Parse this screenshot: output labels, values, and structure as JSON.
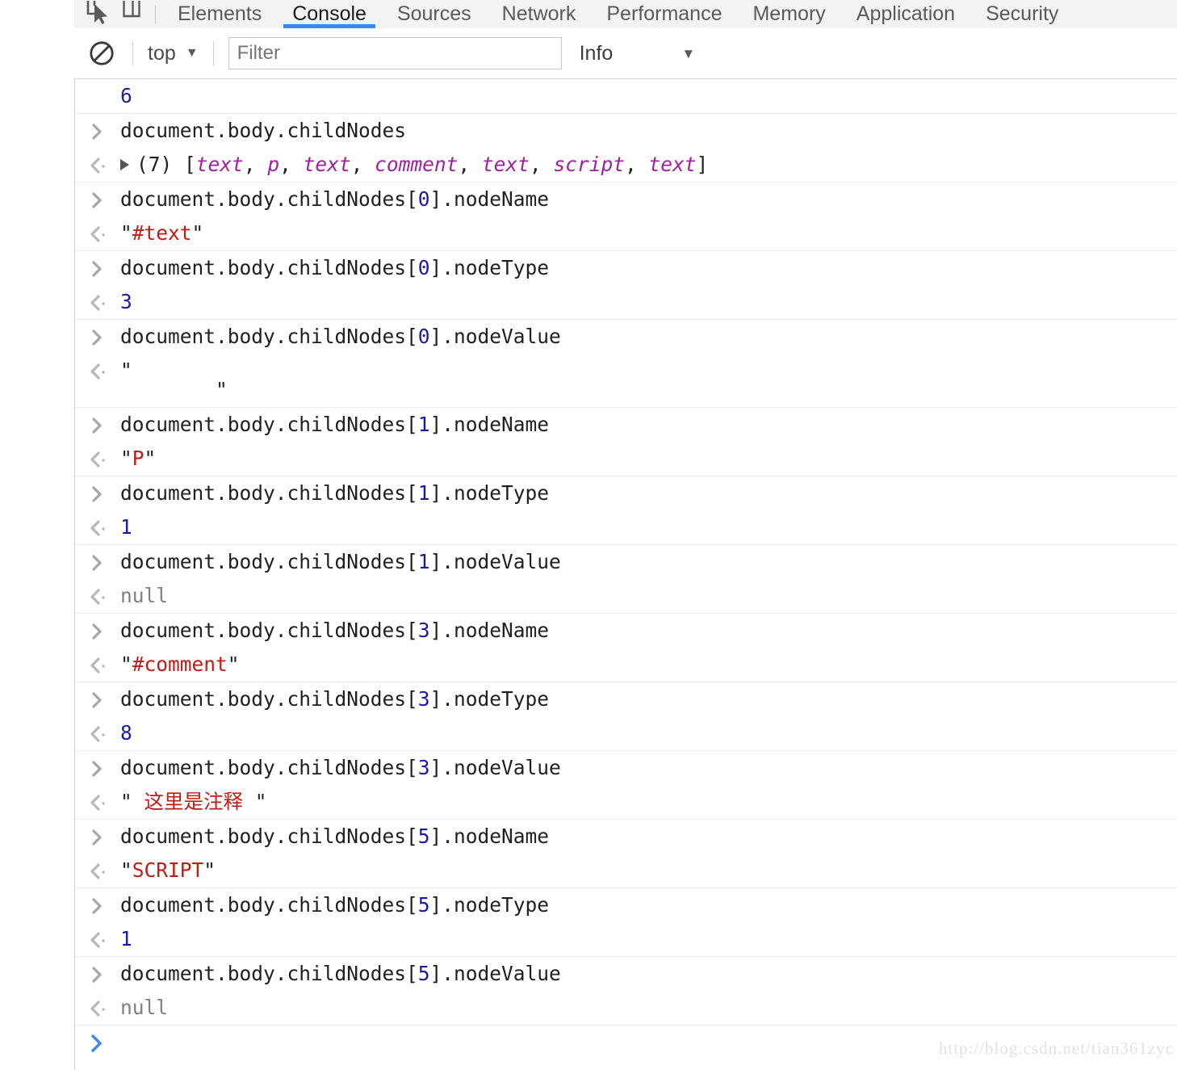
{
  "tabbar": {
    "icons": [
      {
        "name": "inspect-element-icon",
        "label": "Inspect element"
      },
      {
        "name": "device-toolbar-icon",
        "label": "Toggle device toolbar"
      }
    ],
    "tabs": [
      {
        "label": "Elements",
        "active": false
      },
      {
        "label": "Console",
        "active": true
      },
      {
        "label": "Sources",
        "active": false
      },
      {
        "label": "Network",
        "active": false
      },
      {
        "label": "Performance",
        "active": false
      },
      {
        "label": "Memory",
        "active": false
      },
      {
        "label": "Application",
        "active": false
      },
      {
        "label": "Security",
        "active": false
      }
    ],
    "active_tab_underline_color": "#4285f4"
  },
  "toolbar": {
    "clear_icon": "clear-console-icon",
    "context_label": "top",
    "context_caret": "▼",
    "filter_placeholder": "Filter",
    "filter_value": "",
    "level_label": "Info",
    "level_caret": "▼"
  },
  "console": {
    "prompt_symbol": "❯",
    "input_arrow": "input-arrow-icon",
    "output_arrow": "output-arrow-icon",
    "messages": [
      {
        "kind": "result",
        "group_start": false,
        "gutter": "none",
        "tokens": [
          {
            "t": "6",
            "c": "num"
          }
        ]
      },
      {
        "kind": "command",
        "group_start": true,
        "gutter": "input",
        "tokens": [
          {
            "t": "document.body.childNodes",
            "c": "plain"
          }
        ]
      },
      {
        "kind": "result",
        "group_start": false,
        "gutter": "output",
        "disclosure": true,
        "tokens": [
          {
            "t": "(7) ",
            "c": "plain"
          },
          {
            "t": "[",
            "c": "plain"
          },
          {
            "t": "text",
            "c": "node"
          },
          {
            "t": ", ",
            "c": "plain"
          },
          {
            "t": "p",
            "c": "node"
          },
          {
            "t": ", ",
            "c": "plain"
          },
          {
            "t": "text",
            "c": "node"
          },
          {
            "t": ", ",
            "c": "plain"
          },
          {
            "t": "comment",
            "c": "node"
          },
          {
            "t": ", ",
            "c": "plain"
          },
          {
            "t": "text",
            "c": "node"
          },
          {
            "t": ", ",
            "c": "plain"
          },
          {
            "t": "script",
            "c": "node"
          },
          {
            "t": ", ",
            "c": "plain"
          },
          {
            "t": "text",
            "c": "node"
          },
          {
            "t": "]",
            "c": "plain"
          }
        ]
      },
      {
        "kind": "command",
        "group_start": true,
        "gutter": "input",
        "tokens": [
          {
            "t": "document.body.childNodes[",
            "c": "plain"
          },
          {
            "t": "0",
            "c": "num"
          },
          {
            "t": "].nodeName",
            "c": "plain"
          }
        ]
      },
      {
        "kind": "result",
        "group_start": false,
        "gutter": "output",
        "tokens": [
          {
            "t": "\"",
            "c": "quote"
          },
          {
            "t": "#text",
            "c": "str"
          },
          {
            "t": "\"",
            "c": "quote"
          }
        ]
      },
      {
        "kind": "command",
        "group_start": true,
        "gutter": "input",
        "tokens": [
          {
            "t": "document.body.childNodes[",
            "c": "plain"
          },
          {
            "t": "0",
            "c": "num"
          },
          {
            "t": "].nodeType",
            "c": "plain"
          }
        ]
      },
      {
        "kind": "result",
        "group_start": false,
        "gutter": "output",
        "tokens": [
          {
            "t": "3",
            "c": "num"
          }
        ]
      },
      {
        "kind": "command",
        "group_start": true,
        "gutter": "input",
        "tokens": [
          {
            "t": "document.body.childNodes[",
            "c": "plain"
          },
          {
            "t": "0",
            "c": "num"
          },
          {
            "t": "].nodeValue",
            "c": "plain"
          }
        ]
      },
      {
        "kind": "result",
        "group_start": false,
        "gutter": "output",
        "tokens": [
          {
            "t": "\"\n        \"",
            "c": "quote"
          }
        ]
      },
      {
        "kind": "command",
        "group_start": true,
        "gutter": "input",
        "tokens": [
          {
            "t": "document.body.childNodes[",
            "c": "plain"
          },
          {
            "t": "1",
            "c": "num"
          },
          {
            "t": "].nodeName",
            "c": "plain"
          }
        ]
      },
      {
        "kind": "result",
        "group_start": false,
        "gutter": "output",
        "tokens": [
          {
            "t": "\"",
            "c": "quote"
          },
          {
            "t": "P",
            "c": "str"
          },
          {
            "t": "\"",
            "c": "quote"
          }
        ]
      },
      {
        "kind": "command",
        "group_start": true,
        "gutter": "input",
        "tokens": [
          {
            "t": "document.body.childNodes[",
            "c": "plain"
          },
          {
            "t": "1",
            "c": "num"
          },
          {
            "t": "].nodeType",
            "c": "plain"
          }
        ]
      },
      {
        "kind": "result",
        "group_start": false,
        "gutter": "output",
        "tokens": [
          {
            "t": "1",
            "c": "num"
          }
        ]
      },
      {
        "kind": "command",
        "group_start": true,
        "gutter": "input",
        "tokens": [
          {
            "t": "document.body.childNodes[",
            "c": "plain"
          },
          {
            "t": "1",
            "c": "num"
          },
          {
            "t": "].nodeValue",
            "c": "plain"
          }
        ]
      },
      {
        "kind": "result",
        "group_start": false,
        "gutter": "output",
        "tokens": [
          {
            "t": "null",
            "c": "null"
          }
        ]
      },
      {
        "kind": "command",
        "group_start": true,
        "gutter": "input",
        "tokens": [
          {
            "t": "document.body.childNodes[",
            "c": "plain"
          },
          {
            "t": "3",
            "c": "num"
          },
          {
            "t": "].nodeName",
            "c": "plain"
          }
        ]
      },
      {
        "kind": "result",
        "group_start": false,
        "gutter": "output",
        "tokens": [
          {
            "t": "\"",
            "c": "quote"
          },
          {
            "t": "#comment",
            "c": "str"
          },
          {
            "t": "\"",
            "c": "quote"
          }
        ]
      },
      {
        "kind": "command",
        "group_start": true,
        "gutter": "input",
        "tokens": [
          {
            "t": "document.body.childNodes[",
            "c": "plain"
          },
          {
            "t": "3",
            "c": "num"
          },
          {
            "t": "].nodeType",
            "c": "plain"
          }
        ]
      },
      {
        "kind": "result",
        "group_start": false,
        "gutter": "output",
        "tokens": [
          {
            "t": "8",
            "c": "num"
          }
        ]
      },
      {
        "kind": "command",
        "group_start": true,
        "gutter": "input",
        "tokens": [
          {
            "t": "document.body.childNodes[",
            "c": "plain"
          },
          {
            "t": "3",
            "c": "num"
          },
          {
            "t": "].nodeValue",
            "c": "plain"
          }
        ]
      },
      {
        "kind": "result",
        "group_start": false,
        "gutter": "output",
        "tokens": [
          {
            "t": "\" ",
            "c": "quote"
          },
          {
            "t": "这里是注释",
            "c": "str"
          },
          {
            "t": " \"",
            "c": "quote"
          }
        ]
      },
      {
        "kind": "command",
        "group_start": true,
        "gutter": "input",
        "tokens": [
          {
            "t": "document.body.childNodes[",
            "c": "plain"
          },
          {
            "t": "5",
            "c": "num"
          },
          {
            "t": "].nodeName",
            "c": "plain"
          }
        ]
      },
      {
        "kind": "result",
        "group_start": false,
        "gutter": "output",
        "tokens": [
          {
            "t": "\"",
            "c": "quote"
          },
          {
            "t": "SCRIPT",
            "c": "str"
          },
          {
            "t": "\"",
            "c": "quote"
          }
        ]
      },
      {
        "kind": "command",
        "group_start": true,
        "gutter": "input",
        "tokens": [
          {
            "t": "document.body.childNodes[",
            "c": "plain"
          },
          {
            "t": "5",
            "c": "num"
          },
          {
            "t": "].nodeType",
            "c": "plain"
          }
        ]
      },
      {
        "kind": "result",
        "group_start": false,
        "gutter": "output",
        "tokens": [
          {
            "t": "1",
            "c": "num"
          }
        ]
      },
      {
        "kind": "command",
        "group_start": true,
        "gutter": "input",
        "tokens": [
          {
            "t": "document.body.childNodes[",
            "c": "plain"
          },
          {
            "t": "5",
            "c": "num"
          },
          {
            "t": "].nodeValue",
            "c": "plain"
          }
        ]
      },
      {
        "kind": "result",
        "group_start": false,
        "gutter": "output",
        "tokens": [
          {
            "t": "null",
            "c": "null"
          }
        ]
      }
    ]
  },
  "watermark": {
    "text": "http://blog.csdn.net/tian361zyc"
  }
}
